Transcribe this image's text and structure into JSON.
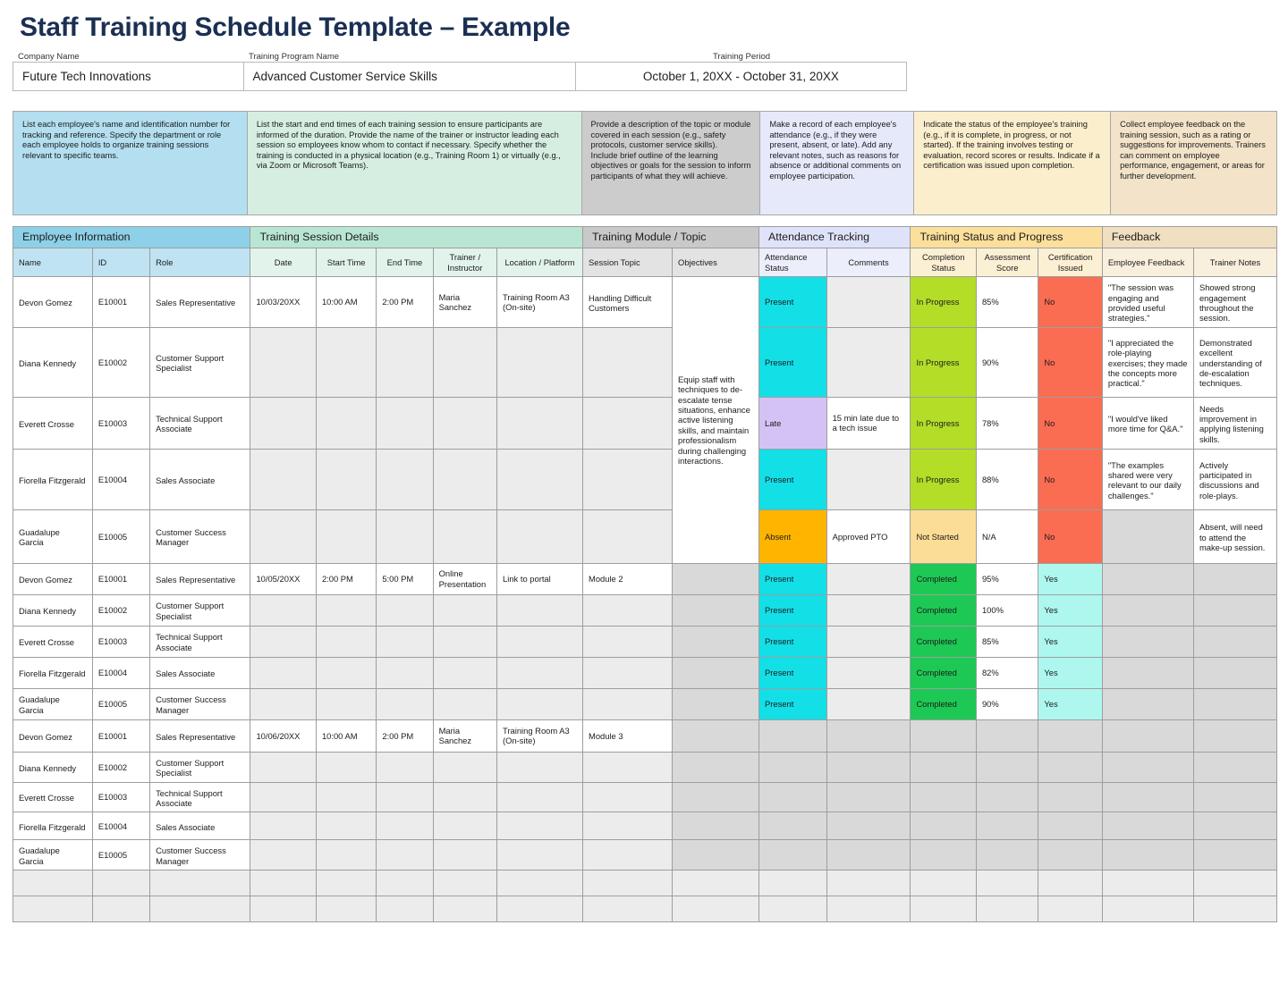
{
  "page_title": "Staff Training Schedule Template – Example",
  "meta": {
    "labels": [
      "Company Name",
      "Training Program Name",
      "Training Period"
    ],
    "values": [
      "Future Tech Innovations",
      "Advanced Customer Service Skills",
      "October 1, 20XX - October 31, 20XX"
    ]
  },
  "instructions": [
    "List each employee's name and identification number for tracking and reference. Specify the department or role each employee holds to organize training sessions relevant to specific teams.",
    "List the start and end times of each training session to ensure participants are informed of the duration. Provide the name of the trainer or instructor leading each session so employees know whom to contact if necessary. Specify whether the training is conducted in a physical location (e.g., Training Room 1) or virtually (e.g., via Zoom or Microsoft Teams).",
    "Provide a description of the topic or module covered in each session (e.g., safety protocols, customer service skills).\nInclude brief outline of the learning objectives or goals for the session to inform participants of what they will achieve.",
    "Make a record of each employee's attendance (e.g., if they were present, absent, or late). Add any relevant notes, such as reasons for absence or additional comments on employee participation.",
    "Indicate the status of the employee's training (e.g., if it is complete, in progress, or not started). If the training involves testing or evaluation, record scores or results. Indicate if a certification was issued upon completion.",
    "Collect employee feedback on the training session, such as a rating or suggestions for improvements. Trainers can comment on employee performance, engagement, or areas for further development."
  ],
  "groups": [
    "Employee Information",
    "Training Session Details",
    "Training Module / Topic",
    "Attendance Tracking",
    "Training Status and Progress",
    "Feedback"
  ],
  "columns": [
    "Name",
    "ID",
    "Role",
    "Date",
    "Start Time",
    "End Time",
    "Trainer / Instructor",
    "Location / Platform",
    "Session Topic",
    "Objectives",
    "Attendance Status",
    "Comments",
    "Completion Status",
    "Assessment Score",
    "Certification Issued",
    "Employee Feedback",
    "Trainer Notes"
  ],
  "colors": {
    "group_employee": "#8dd0e8",
    "group_session": "#b9e6d3",
    "group_module": "#c9c9c9",
    "group_attendance": "#dfe3fa",
    "group_status": "#fcdf9b",
    "group_feedback": "#f0dfc0",
    "present": "#13dfe7",
    "late": "#d5c2f5",
    "absent": "#ffb500",
    "in_progress": "#b4dd28",
    "not_started": "#fcdd96",
    "completed": "#1dc954",
    "cert_no": "#fa6d52",
    "cert_yes": "#adf7ee",
    "title": "#1a2f52"
  },
  "blocks": [
    {
      "session": {
        "date": "10/03/20XX",
        "start_time": "10:00 AM",
        "end_time": "2:00 PM",
        "trainer": "Maria Sanchez",
        "location": "Training Room A3 (On-site)",
        "topic": "Handling Difficult Customers",
        "objectives": "Equip staff with techniques to de-escalate tense situations, enhance active listening skills, and maintain professionalism during challenging interactions."
      },
      "rows": [
        {
          "name": "Devon Gomez",
          "id": "E10001",
          "role": "Sales Representative",
          "attendance": "Present",
          "attendance_state": "present",
          "comments": "",
          "completion": "In Progress",
          "completion_state": "inprog",
          "score": "85%",
          "certification": "No",
          "certification_state": "no",
          "employee_feedback": "\"The session was engaging and provided useful strategies.\"",
          "trainer_notes": "Showed strong engagement throughout the session."
        },
        {
          "name": "Diana Kennedy",
          "id": "E10002",
          "role": "Customer Support Specialist",
          "attendance": "Present",
          "attendance_state": "present",
          "comments": "",
          "completion": "In Progress",
          "completion_state": "inprog",
          "score": "90%",
          "certification": "No",
          "certification_state": "no",
          "employee_feedback": "\"I appreciated the role-playing exercises; they made the concepts more practical.\"",
          "trainer_notes": "Demonstrated excellent understanding of de-escalation techniques."
        },
        {
          "name": "Everett Crosse",
          "id": "E10003",
          "role": "Technical Support Associate",
          "attendance": "Late",
          "attendance_state": "late",
          "comments": "15 min late due to a tech issue",
          "completion": "In Progress",
          "completion_state": "inprog",
          "score": "78%",
          "certification": "No",
          "certification_state": "no",
          "employee_feedback": "\"I would've liked more time for Q&A.\"",
          "trainer_notes": "Needs improvement in applying listening skills."
        },
        {
          "name": "Fiorella Fitzgerald",
          "id": "E10004",
          "role": "Sales Associate",
          "attendance": "Present",
          "attendance_state": "present",
          "comments": "",
          "completion": "In Progress",
          "completion_state": "inprog",
          "score": "88%",
          "certification": "No",
          "certification_state": "no",
          "employee_feedback": "\"The examples shared were very relevant to our daily challenges.\"",
          "trainer_notes": "Actively participated in discussions and role-plays."
        },
        {
          "name": "Guadalupe Garcia",
          "id": "E10005",
          "role": "Customer Success Manager",
          "attendance": "Absent",
          "attendance_state": "absent",
          "comments": "Approved PTO",
          "completion": "Not Started",
          "completion_state": "notstart",
          "score": "N/A",
          "certification": "No",
          "certification_state": "no",
          "employee_feedback": "",
          "trainer_notes": "Absent, will need to attend the make-up session."
        }
      ]
    },
    {
      "session": {
        "date": "10/05/20XX",
        "start_time": "2:00 PM",
        "end_time": "5:00 PM",
        "trainer": "Online Presentation",
        "location": "Link to portal",
        "topic": "Module 2",
        "objectives": ""
      },
      "rows": [
        {
          "name": "Devon Gomez",
          "id": "E10001",
          "role": "Sales Representative",
          "attendance": "Present",
          "attendance_state": "present",
          "comments": "",
          "completion": "Completed",
          "completion_state": "complete",
          "score": "95%",
          "certification": "Yes",
          "certification_state": "yes",
          "employee_feedback": "",
          "trainer_notes": ""
        },
        {
          "name": "Diana Kennedy",
          "id": "E10002",
          "role": "Customer Support Specialist",
          "attendance": "Present",
          "attendance_state": "present",
          "comments": "",
          "completion": "Completed",
          "completion_state": "complete",
          "score": "100%",
          "certification": "Yes",
          "certification_state": "yes",
          "employee_feedback": "",
          "trainer_notes": ""
        },
        {
          "name": "Everett Crosse",
          "id": "E10003",
          "role": "Technical Support Associate",
          "attendance": "Present",
          "attendance_state": "present",
          "comments": "",
          "completion": "Completed",
          "completion_state": "complete",
          "score": "85%",
          "certification": "Yes",
          "certification_state": "yes",
          "employee_feedback": "",
          "trainer_notes": ""
        },
        {
          "name": "Fiorella Fitzgerald",
          "id": "E10004",
          "role": "Sales Associate",
          "attendance": "Present",
          "attendance_state": "present",
          "comments": "",
          "completion": "Completed",
          "completion_state": "complete",
          "score": "82%",
          "certification": "Yes",
          "certification_state": "yes",
          "employee_feedback": "",
          "trainer_notes": ""
        },
        {
          "name": "Guadalupe Garcia",
          "id": "E10005",
          "role": "Customer Success Manager",
          "attendance": "Present",
          "attendance_state": "present",
          "comments": "",
          "completion": "Completed",
          "completion_state": "complete",
          "score": "90%",
          "certification": "Yes",
          "certification_state": "yes",
          "employee_feedback": "",
          "trainer_notes": ""
        }
      ]
    },
    {
      "session": {
        "date": "10/06/20XX",
        "start_time": "10:00 AM",
        "end_time": "2:00 PM",
        "trainer": "Maria Sanchez",
        "location": "Training Room A3 (On-site)",
        "topic": "Module 3",
        "objectives": ""
      },
      "rows": [
        {
          "name": "Devon Gomez",
          "id": "E10001",
          "role": "Sales Representative",
          "attendance": "",
          "attendance_state": "",
          "comments": "",
          "completion": "",
          "completion_state": "",
          "score": "",
          "certification": "",
          "certification_state": "",
          "employee_feedback": "",
          "trainer_notes": ""
        },
        {
          "name": "Diana Kennedy",
          "id": "E10002",
          "role": "Customer Support Specialist",
          "attendance": "",
          "attendance_state": "",
          "comments": "",
          "completion": "",
          "completion_state": "",
          "score": "",
          "certification": "",
          "certification_state": "",
          "employee_feedback": "",
          "trainer_notes": ""
        },
        {
          "name": "Everett Crosse",
          "id": "E10003",
          "role": "Technical Support Associate",
          "attendance": "",
          "attendance_state": "",
          "comments": "",
          "completion": "",
          "completion_state": "",
          "score": "",
          "certification": "",
          "certification_state": "",
          "employee_feedback": "",
          "trainer_notes": ""
        },
        {
          "name": "Fiorella Fitzgerald",
          "id": "E10004",
          "role": "Sales Associate",
          "attendance": "",
          "attendance_state": "",
          "comments": "",
          "completion": "",
          "completion_state": "",
          "score": "",
          "certification": "",
          "certification_state": "",
          "employee_feedback": "",
          "trainer_notes": ""
        },
        {
          "name": "Guadalupe Garcia",
          "id": "E10005",
          "role": "Customer Success Manager",
          "attendance": "",
          "attendance_state": "",
          "comments": "",
          "completion": "",
          "completion_state": "",
          "score": "",
          "certification": "",
          "certification_state": "",
          "employee_feedback": "",
          "trainer_notes": ""
        }
      ]
    }
  ],
  "blank_rows": 2
}
